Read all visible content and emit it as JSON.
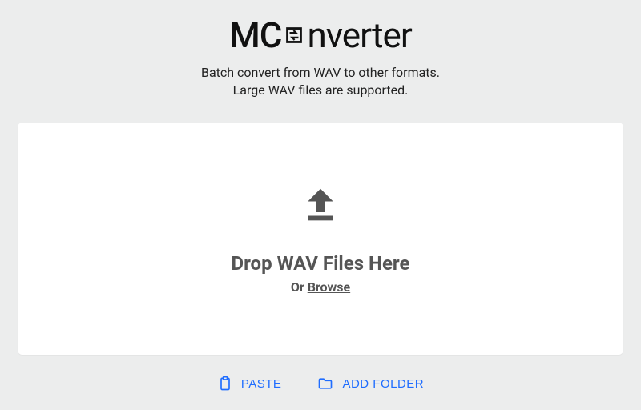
{
  "logo": {
    "pre": "MC",
    "post": "nverter"
  },
  "subtitle": {
    "line1": "Batch convert from WAV to other formats.",
    "line2": "Large WAV files are supported."
  },
  "dropzone": {
    "title": "Drop WAV Files Here",
    "or_prefix": "Or ",
    "browse_label": "Browse"
  },
  "actions": {
    "paste": "PASTE",
    "add_folder": "ADD FOLDER"
  },
  "colors": {
    "accent": "#1f6dff",
    "bg": "#eceded",
    "card": "#ffffff",
    "muted": "#555555"
  }
}
